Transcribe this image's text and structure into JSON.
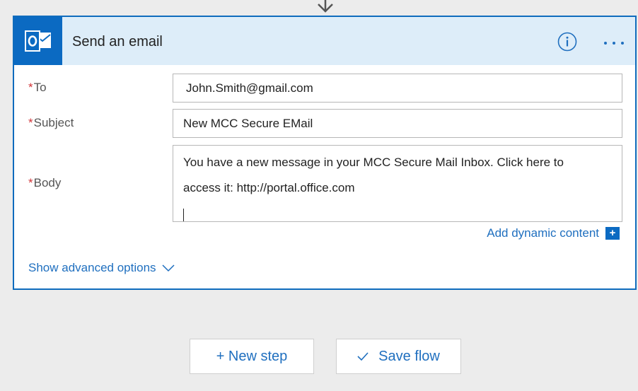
{
  "action": {
    "title": "Send an email",
    "icon": "outlook-icon"
  },
  "fields": {
    "to": {
      "label": "To",
      "value": "John.Smith@gmail.com"
    },
    "subject": {
      "label": "Subject",
      "value": "New MCC Secure EMail"
    },
    "body": {
      "label": "Body",
      "lines": [
        "You have a new message in your MCC Secure Mail Inbox.  Click here to",
        "access it:  http://portal.office.com"
      ]
    }
  },
  "required_marker": "*",
  "links": {
    "dynamic_content": "Add dynamic content",
    "advanced_options": "Show advanced options"
  },
  "buttons": {
    "new_step": "+ New step",
    "save_flow": "Save flow"
  },
  "colors": {
    "accent": "#0f6cbd",
    "header_bg": "#ddedf9",
    "link": "#1f6fbf",
    "required": "#d13438",
    "page_bg": "#ececec"
  }
}
